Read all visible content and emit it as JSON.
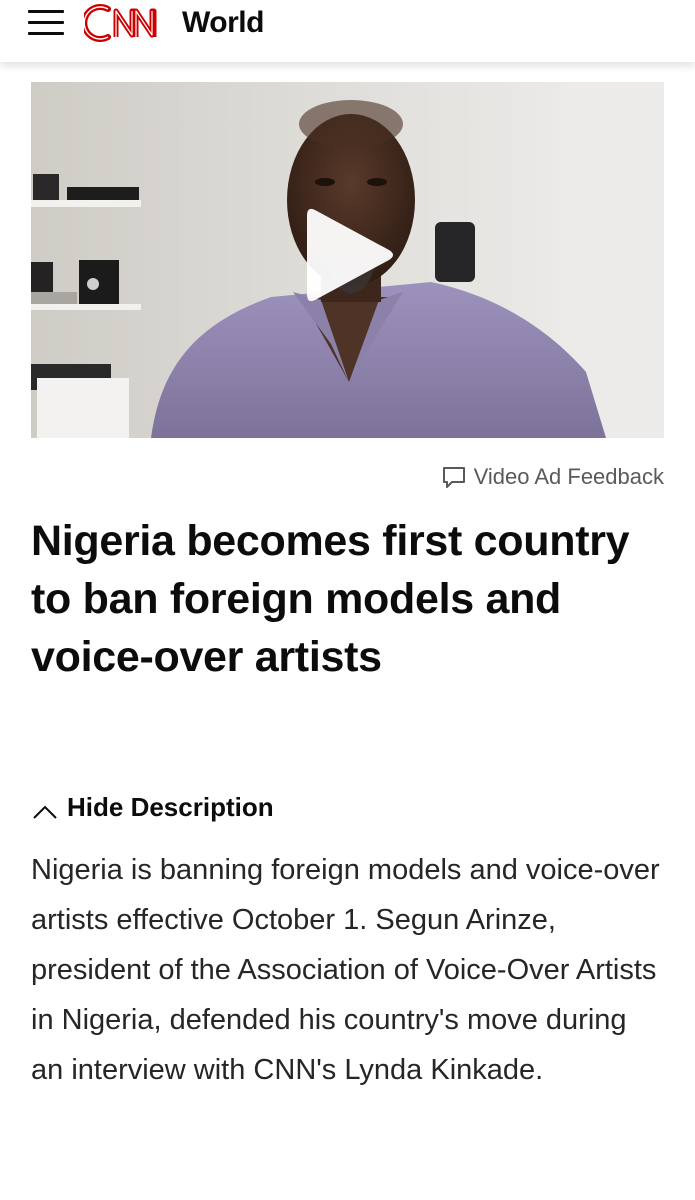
{
  "header": {
    "menu_icon": "hamburger-menu-icon",
    "logo_text": "CNN",
    "logo_color": "#cc0000",
    "section": "World"
  },
  "video": {
    "play_icon": "play-icon",
    "feedback_icon": "speech-bubble-icon",
    "feedback_label": "Video Ad Feedback"
  },
  "article": {
    "headline": "Nigeria becomes first country to ban foreign models and voice-over artists",
    "toggle_icon": "chevron-up-icon",
    "toggle_label": "Hide Description",
    "description": "Nigeria is banning foreign models and voice-over artists effective October 1. Segun Arinze, president of the Association of Voice-Over Artists in Nigeria, defended his country's move during an interview with CNN's Lynda Kinkade."
  }
}
